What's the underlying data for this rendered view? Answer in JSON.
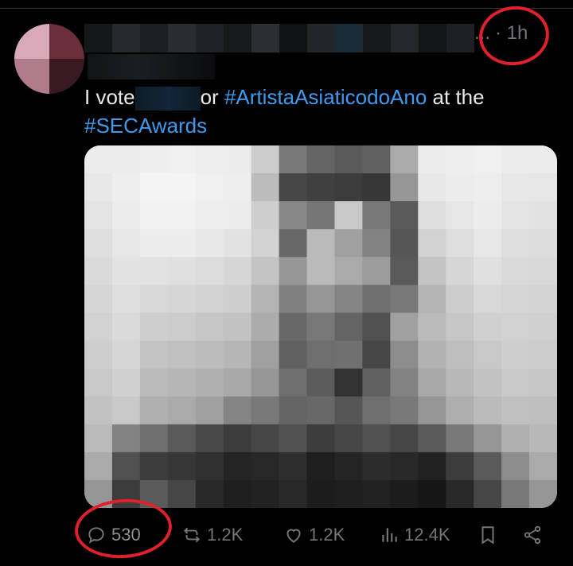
{
  "tweet": {
    "header": {
      "dots": "...",
      "time": "· 1h"
    },
    "text": {
      "part1": "I vote",
      "part2": "or ",
      "hashtag1": "#ArtistaAsiaticodoAno",
      "part3": " at the",
      "hashtag2": "#SECAwards"
    },
    "actions": {
      "replies": "530",
      "retweets": "1.2K",
      "likes": "1.2K",
      "views": "12.4K"
    }
  },
  "colors": {
    "background": "#000000",
    "text": "#e7e9ea",
    "muted": "#71767b",
    "hashtag": "#3d9bf0",
    "annotation": "#e0202a"
  },
  "icons": {
    "reply": "reply-icon",
    "retweet": "retweet-icon",
    "like": "heart-icon",
    "views": "views-icon",
    "bookmark": "bookmark-icon",
    "share": "share-icon"
  }
}
